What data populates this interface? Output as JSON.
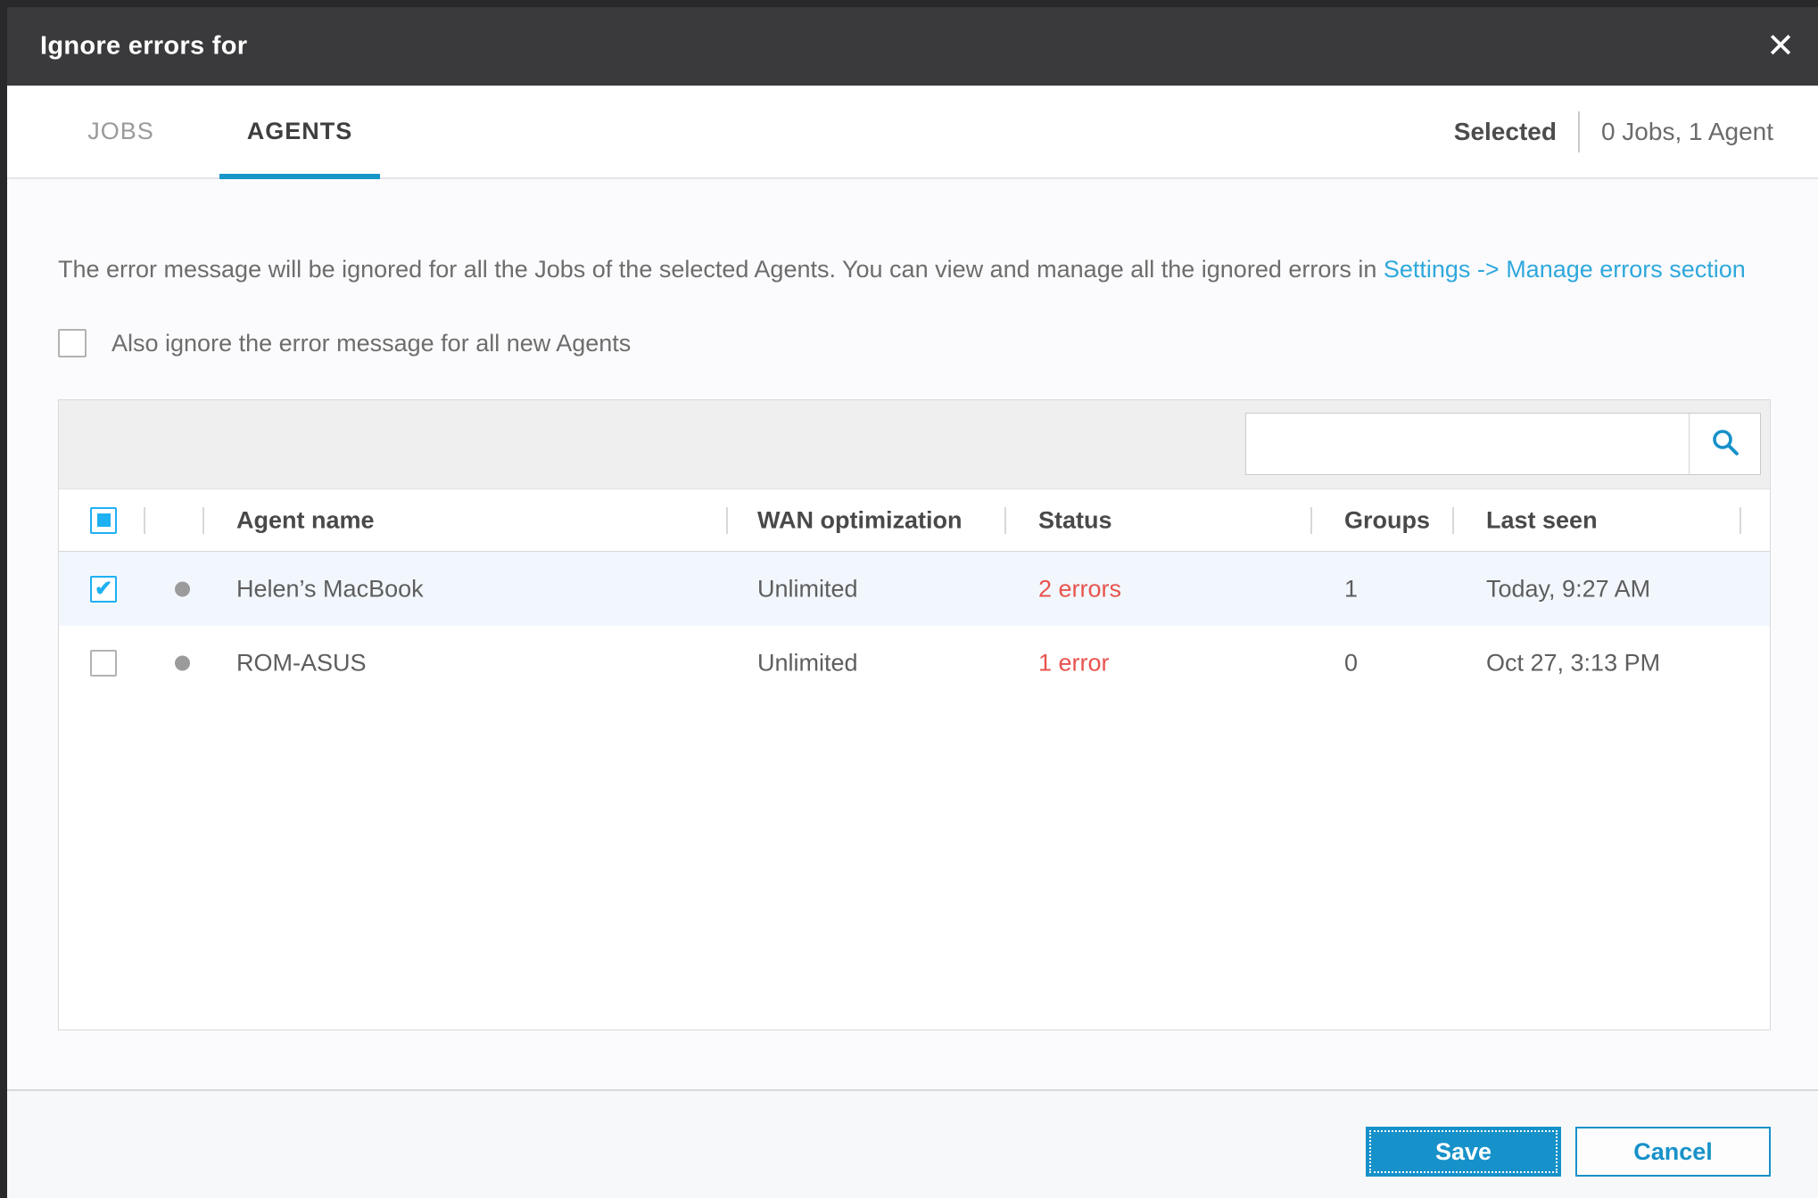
{
  "modal": {
    "title": "Ignore errors for"
  },
  "icons": {
    "close": "✕",
    "check": "✔"
  },
  "tabs": [
    {
      "label": "JOBS",
      "active": false
    },
    {
      "label": "AGENTS",
      "active": true
    }
  ],
  "summary": {
    "label": "Selected",
    "value": "0 Jobs, 1 Agent"
  },
  "description": {
    "text": "The error message will be ignored for all the Jobs of the selected Agents. You can view and manage all the ignored errors in ",
    "link": "Settings -> Manage errors section"
  },
  "ignore_checkbox": {
    "label": "Also ignore the error message for all new Agents",
    "checked": false
  },
  "table": {
    "search": {
      "value": "",
      "icon": "search-magnifier"
    },
    "select_all_state": "indeterminate",
    "columns": [
      "Agent name",
      "WAN optimization",
      "Status",
      "Groups",
      "Last seen"
    ],
    "rows": [
      {
        "checked": true,
        "selected": true,
        "agent_name": "Helen’s MacBook",
        "wan": "Unlimited",
        "status": "2 errors",
        "groups": "1",
        "last_seen": "Today, 9:27 AM"
      },
      {
        "checked": false,
        "selected": false,
        "agent_name": "ROM-ASUS",
        "wan": "Unlimited",
        "status": "1 error",
        "groups": "0",
        "last_seen": "Oct 27, 3:13 PM"
      }
    ]
  },
  "footer": {
    "save_label": "Save",
    "cancel_label": "Cancel"
  },
  "colors": {
    "accent_blue": "#1791c9",
    "checkbox_blue": "#1fb0f2",
    "link_blue": "#2fa8dc",
    "error_red": "#e8534e",
    "header_bg": "#3a3a3c",
    "row_highlight": "#f2f7fd",
    "toolbar_gray": "#efefef"
  }
}
